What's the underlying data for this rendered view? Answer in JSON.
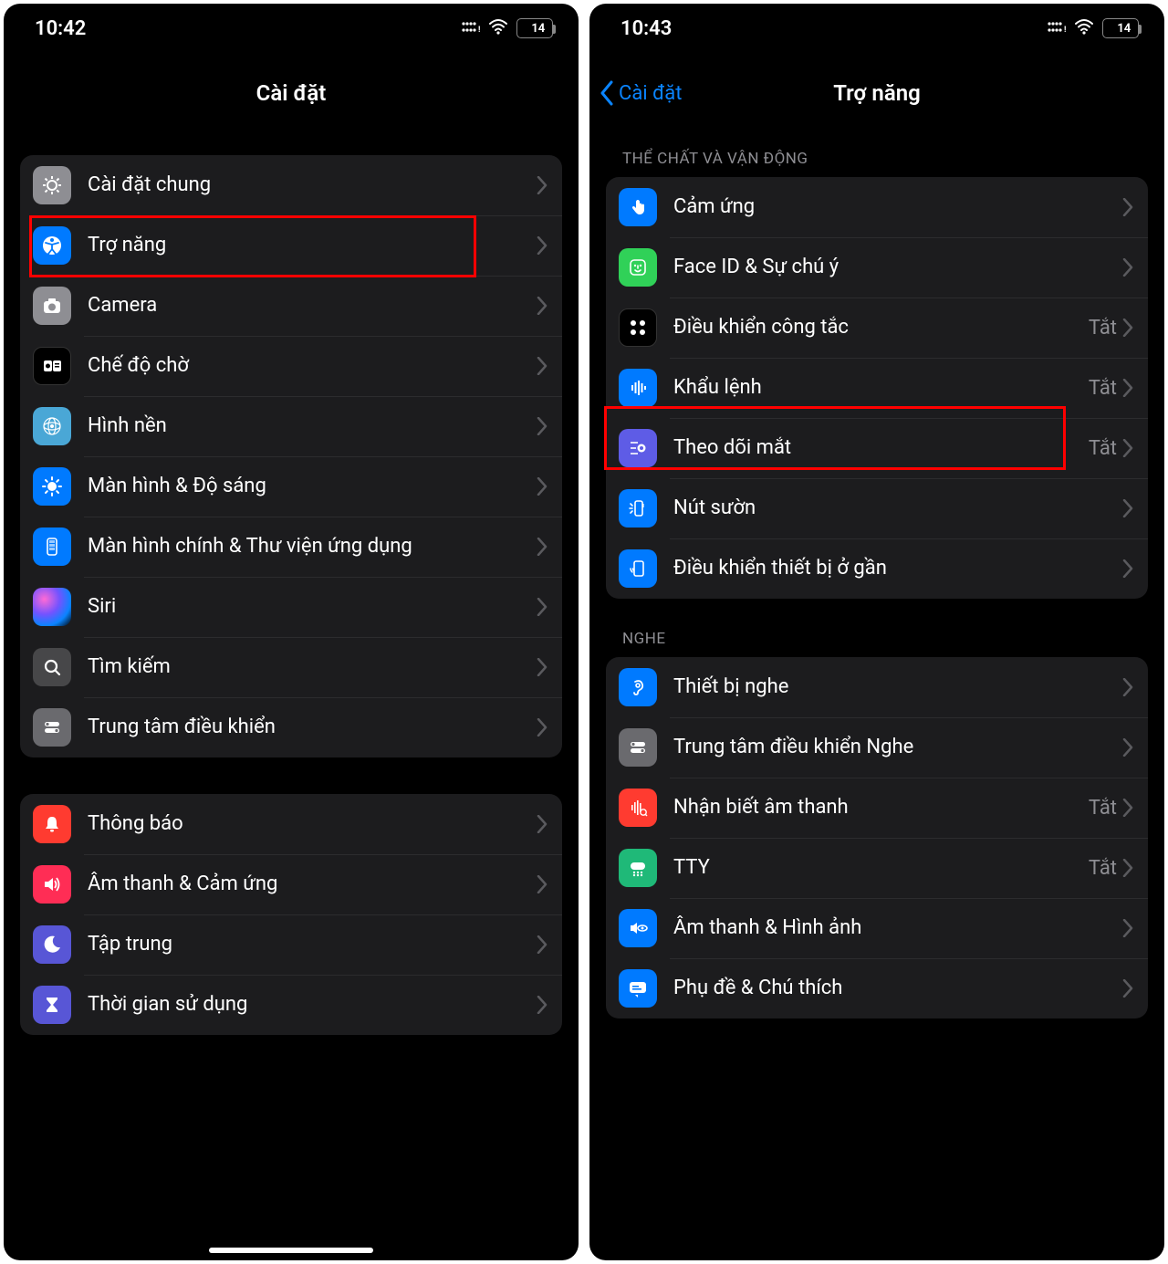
{
  "left": {
    "status": {
      "time": "10:42",
      "battery": "14"
    },
    "title": "Cài đặt",
    "groupA": [
      {
        "label": "Cài đặt chung"
      },
      {
        "label": "Trợ năng"
      },
      {
        "label": "Camera"
      },
      {
        "label": "Chế độ chờ"
      },
      {
        "label": "Hình nền"
      },
      {
        "label": "Màn hình & Độ sáng"
      },
      {
        "label": "Màn hình chính & Thư viện ứng dụng"
      },
      {
        "label": "Siri"
      },
      {
        "label": "Tìm kiếm"
      },
      {
        "label": "Trung tâm điều khiển"
      }
    ],
    "groupB": [
      {
        "label": "Thông báo"
      },
      {
        "label": "Âm thanh & Cảm ứng"
      },
      {
        "label": "Tập trung"
      },
      {
        "label": "Thời gian sử dụng"
      }
    ]
  },
  "right": {
    "status": {
      "time": "10:43",
      "battery": "14"
    },
    "back": "Cài đặt",
    "title": "Trợ năng",
    "header1": "THỂ CHẤT VÀ VẬN ĐỘNG",
    "group1": [
      {
        "label": "Cảm ứng",
        "value": ""
      },
      {
        "label": "Face ID & Sự chú ý",
        "value": ""
      },
      {
        "label": "Điều khiển công tắc",
        "value": "Tắt"
      },
      {
        "label": "Khẩu lệnh",
        "value": "Tắt"
      },
      {
        "label": "Theo dõi mắt",
        "value": "Tắt"
      },
      {
        "label": "Nút sườn",
        "value": ""
      },
      {
        "label": "Điều khiển thiết bị ở gần",
        "value": ""
      }
    ],
    "header2": "NGHE",
    "group2": [
      {
        "label": "Thiết bị nghe",
        "value": ""
      },
      {
        "label": "Trung tâm điều khiển Nghe",
        "value": ""
      },
      {
        "label": "Nhận biết âm thanh",
        "value": "Tắt"
      },
      {
        "label": "TTY",
        "value": "Tắt"
      },
      {
        "label": "Âm thanh & Hình ảnh",
        "value": ""
      },
      {
        "label": "Phụ đề & Chú thích",
        "value": ""
      }
    ]
  }
}
